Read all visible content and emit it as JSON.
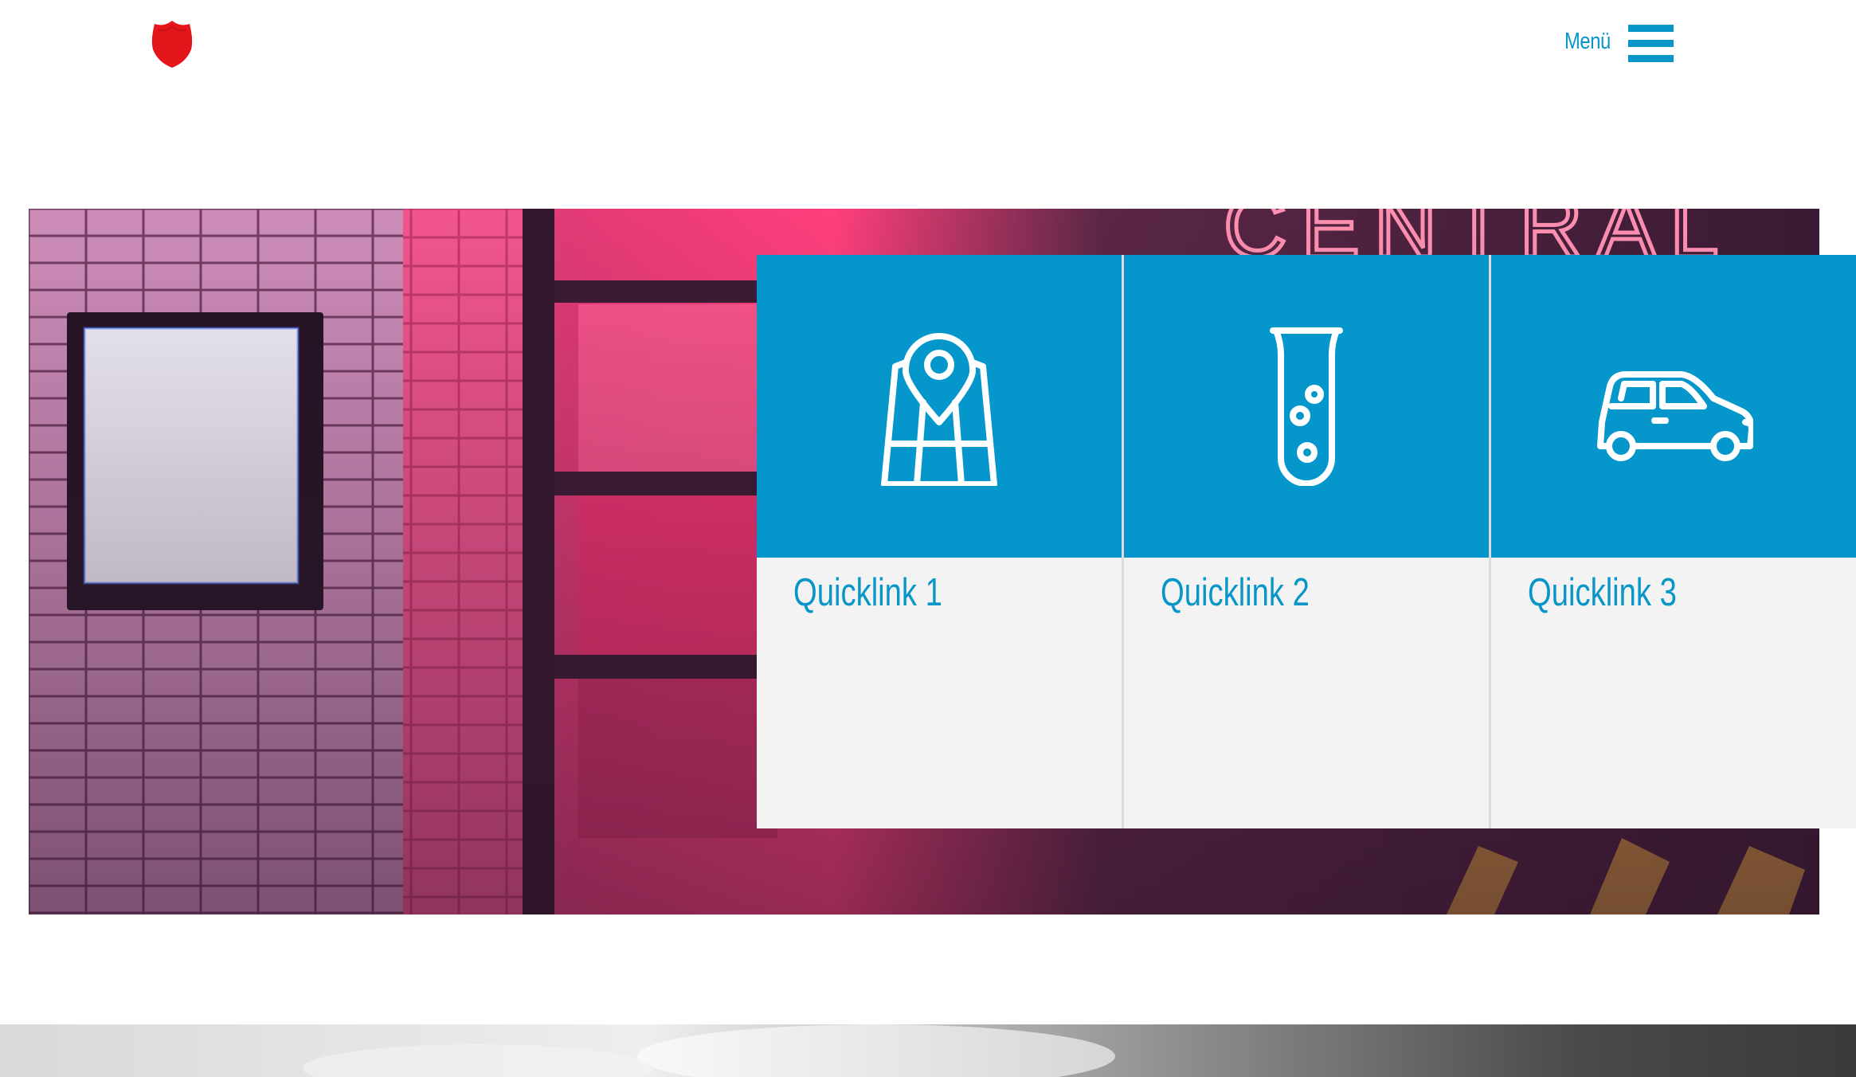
{
  "header": {
    "logo_icon": "red-shield-icon",
    "menu_label": "Menü",
    "menu_icon": "hamburger-icon"
  },
  "colors": {
    "accent": "#0596cc",
    "link_text": "#0896c9",
    "card_background": "#f3f3f3",
    "logo_red": "#e4161b"
  },
  "hero": {
    "image": "neon-pink-storefront-photo",
    "neon_sign_text": "CENTRAL"
  },
  "quicklinks": [
    {
      "label": "Quicklink 1",
      "icon": "map-pin-icon"
    },
    {
      "label": "Quicklink 2",
      "icon": "test-tube-icon"
    },
    {
      "label": "Quicklink 3",
      "icon": "car-icon"
    }
  ],
  "footer": {
    "image": "cloudy-sky-photo"
  }
}
